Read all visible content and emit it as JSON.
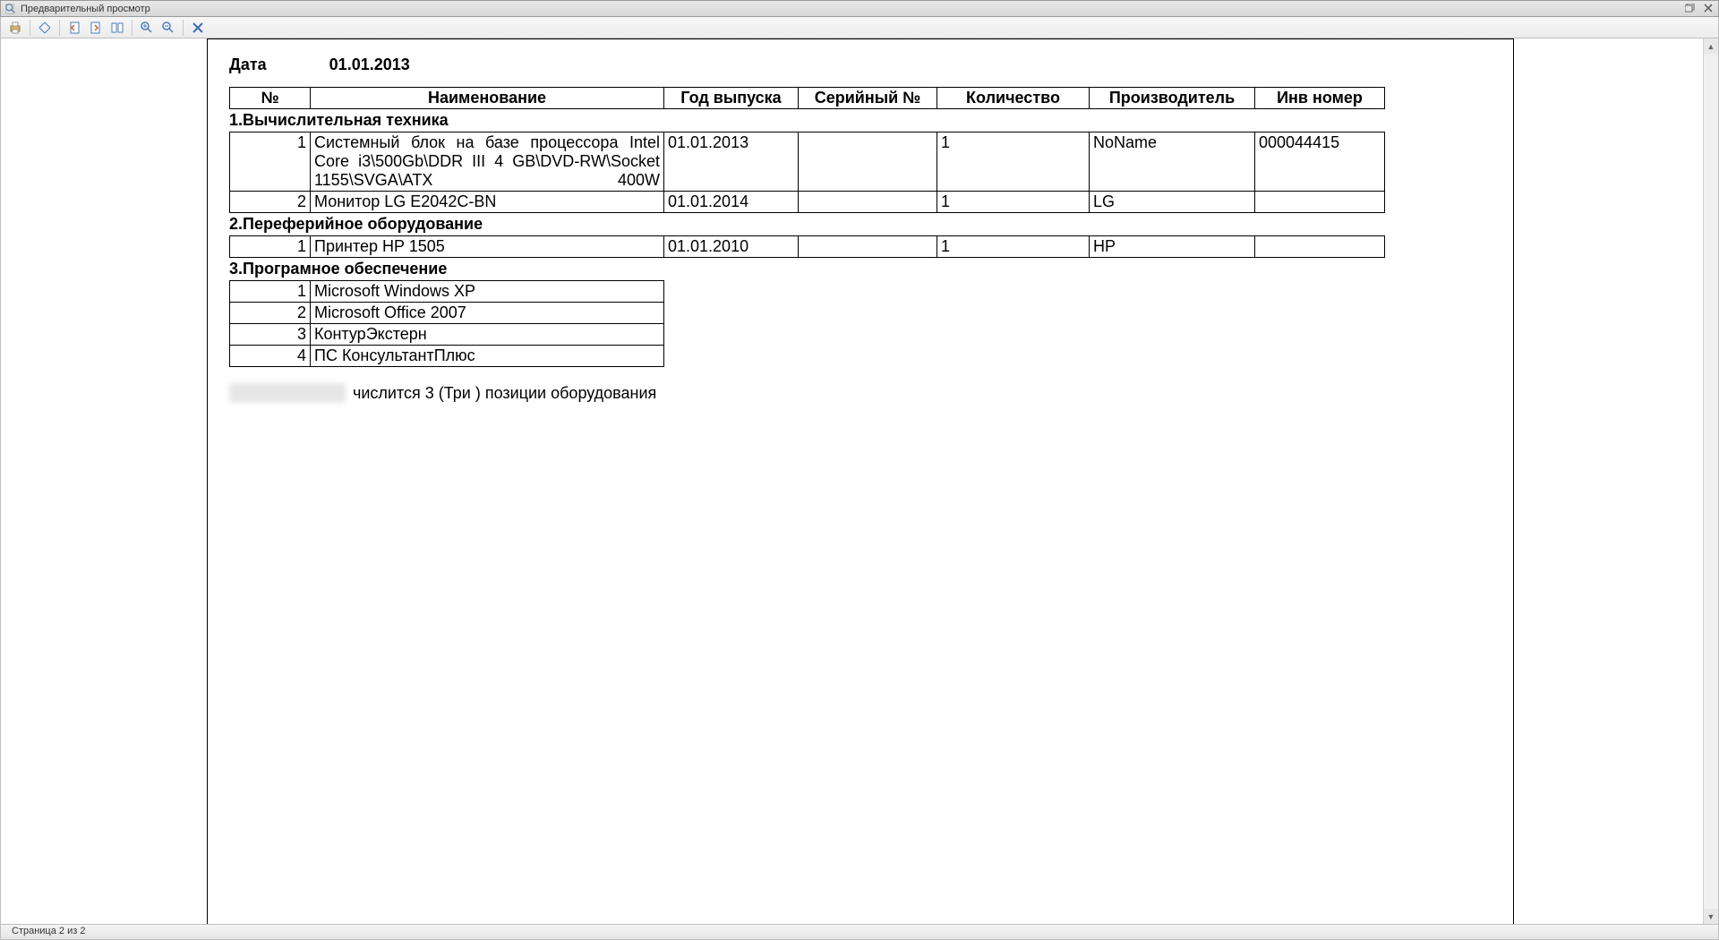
{
  "window": {
    "title": "Предварительный просмотр"
  },
  "toolbar": {
    "print": "print",
    "move": "move",
    "prev": "prev-page",
    "next": "next-page",
    "pages": "multi-page",
    "zoom_in": "zoom-in",
    "zoom_out": "zoom-out",
    "close": "close"
  },
  "document": {
    "date_label": "Дата",
    "date_value": "01.01.2013",
    "columns": {
      "num": "№",
      "name": "Наименование",
      "year": "Год выпуска",
      "serial": "Серийный №",
      "qty": "Количество",
      "maker": "Производитель",
      "inv": "Инв номер"
    },
    "sections": [
      {
        "title": "1.Вычислительная техника",
        "rows": [
          {
            "num": "1",
            "name": "Системный блок на базе процессора Intel Core i3\\500Gb\\DDR III 4 GB\\DVD-RW\\Socket 1155\\SVGA\\ATX 400W",
            "year": "01.01.2013",
            "serial": "",
            "qty": "1",
            "maker": "NoName",
            "inv": "000044415"
          },
          {
            "num": "2",
            "name": "Монитор LG E2042C-BN",
            "year": "01.01.2014",
            "serial": "",
            "qty": "1",
            "maker": "LG",
            "inv": ""
          }
        ]
      },
      {
        "title": "2.Переферийное оборудование",
        "rows": [
          {
            "num": "1",
            "name": "Принтер HP 1505",
            "year": "01.01.2010",
            "serial": "",
            "qty": "1",
            "maker": "HP",
            "inv": ""
          }
        ]
      }
    ],
    "software": {
      "title": "3.Програмное обеспечение",
      "rows": [
        {
          "num": "1",
          "name": "Microsoft Windows XP"
        },
        {
          "num": "2",
          "name": "Microsoft Office 2007"
        },
        {
          "num": "3",
          "name": "КонтурЭкстерн"
        },
        {
          "num": "4",
          "name": "ПС КонсультантПлюс"
        }
      ]
    },
    "summary": "числится 3 (Три ) позиции оборудования"
  },
  "status": {
    "page": "Страница 2 из 2"
  }
}
